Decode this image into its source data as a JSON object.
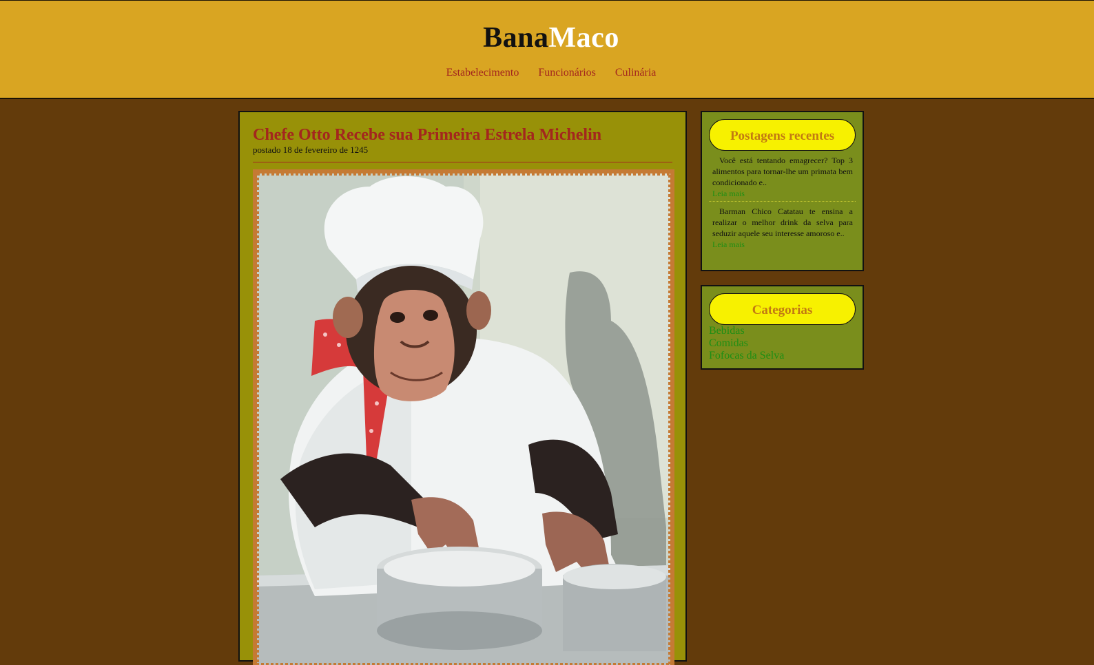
{
  "header": {
    "logo_part1": "Bana",
    "logo_part2": "Maco",
    "nav": [
      "Estabelecimento",
      "Funcionários",
      "Culinária"
    ]
  },
  "post": {
    "title": "Chefe Otto Recebe sua Primeira Estrela Michelin",
    "date": "postado 18 de fevereiro de 1245"
  },
  "recent": {
    "title": "Postagens recentes",
    "items": [
      {
        "excerpt": "Você está tentando emagrecer? Top 3 alimentos para tornar-lhe um primata bem condicionado e..",
        "link": "Leia mais"
      },
      {
        "excerpt": "Barman Chico Catatau te ensina a realizar o melhor drink da selva para seduzir aquele seu interesse amoroso e..",
        "link": "Leia mais"
      }
    ]
  },
  "categories": {
    "title": "Categorias",
    "items": [
      "Bebidas",
      "Comidas",
      "Fofocas da Selva"
    ]
  },
  "colors": {
    "page_background": "#633b0b",
    "header_background": "#d9a522",
    "post_background": "#989108",
    "sidebar_background": "#7a8e1c",
    "widget_title_background": "#f7f100",
    "accent_red": "#a3261e",
    "link_green": "#1e8e14"
  }
}
